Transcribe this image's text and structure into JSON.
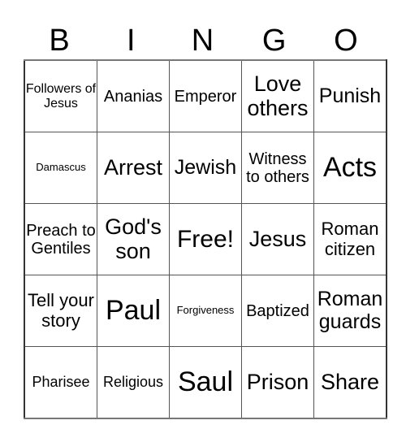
{
  "header": {
    "letters": [
      "B",
      "I",
      "N",
      "G",
      "O"
    ]
  },
  "card": {
    "rows": [
      [
        "Followers of Jesus",
        "Ananias",
        "Emperor",
        "Love others",
        "Punish"
      ],
      [
        "Damascus",
        "Arrest",
        "Jewish",
        "Witness to others",
        "Acts"
      ],
      [
        "Preach to Gentiles",
        "God's son",
        "Free!",
        "Jesus",
        "Roman citizen"
      ],
      [
        "Tell your story",
        "Paul",
        "Forgiveness",
        "Baptized",
        "Roman guards"
      ],
      [
        "Pharisee",
        "Religious",
        "Saul",
        "Prison",
        "Share"
      ]
    ],
    "free_space": "Free!"
  }
}
